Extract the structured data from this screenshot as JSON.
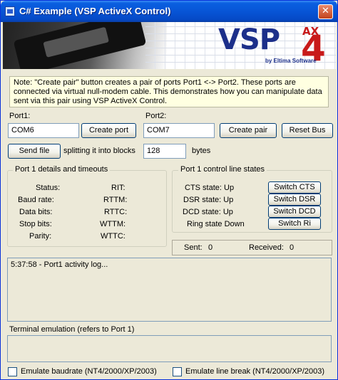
{
  "window": {
    "title": "C# Example (VSP ActiveX Control)",
    "close_glyph": "✕"
  },
  "banner": {
    "logo_main": "VSP",
    "logo_ax": "AX",
    "logo_version": "4",
    "logo_byline": "by Eltima Software"
  },
  "note": {
    "text": "Note: \"Create pair\" button creates a pair of ports Port1 <-> Port2. These ports are connected via virtual null-modem cable. This demonstrates how you can manipulate data sent via this pair using VSP ActiveX Control."
  },
  "port1": {
    "label": "Port1:",
    "value": "COM6",
    "create_button": "Create port"
  },
  "port2": {
    "label": "Port2:",
    "value": "COM7",
    "create_pair_button": "Create pair",
    "reset_bus_button": "Reset Bus"
  },
  "sendfile": {
    "button": "Send file",
    "splitting_label": "splitting it into blocks",
    "block_size": "128",
    "unit": "bytes"
  },
  "details": {
    "title": "Port 1 details and timeouts",
    "status_label": "Status:",
    "baud_label": "Baud rate:",
    "databits_label": "Data bits:",
    "stopbits_label": "Stop bits:",
    "parity_label": "Parity:",
    "rit_label": "RIT:",
    "rttm_label": "RTTM:",
    "rttc_label": "RTTC:",
    "wttm_label": "WTTM:",
    "wttc_label": "WTTC:"
  },
  "control_lines": {
    "title": "Port 1 control line states",
    "cts_state": "CTS state: Up",
    "dsr_state": "DSR state: Up",
    "dcd_state": "DCD state: Up",
    "ring_state": "Ring state Down",
    "switch_cts": "Switch CTS",
    "switch_dsr": "Switch DSR",
    "switch_dcd": "Switch DCD",
    "switch_ri": "Switch Ri"
  },
  "counters": {
    "sent_label": "Sent:",
    "sent_value": "0",
    "received_label": "Received:",
    "received_value": "0"
  },
  "log": {
    "text": "5:37:58 - Port1 activity log..."
  },
  "terminal": {
    "label": "Terminal emulation (refers to Port 1)"
  },
  "options": {
    "emulate_baudrate": "Emulate baudrate (NT4/2000/XP/2003)",
    "emulate_line_break": "Emulate line break (NT4/2000/XP/2003)"
  },
  "colors": {
    "titlebar": "#0755d6",
    "window_bg": "#ece9d8",
    "note_bg": "#ffffe1",
    "logo_blue": "#1c2f8a",
    "logo_red": "#c81a1a"
  }
}
